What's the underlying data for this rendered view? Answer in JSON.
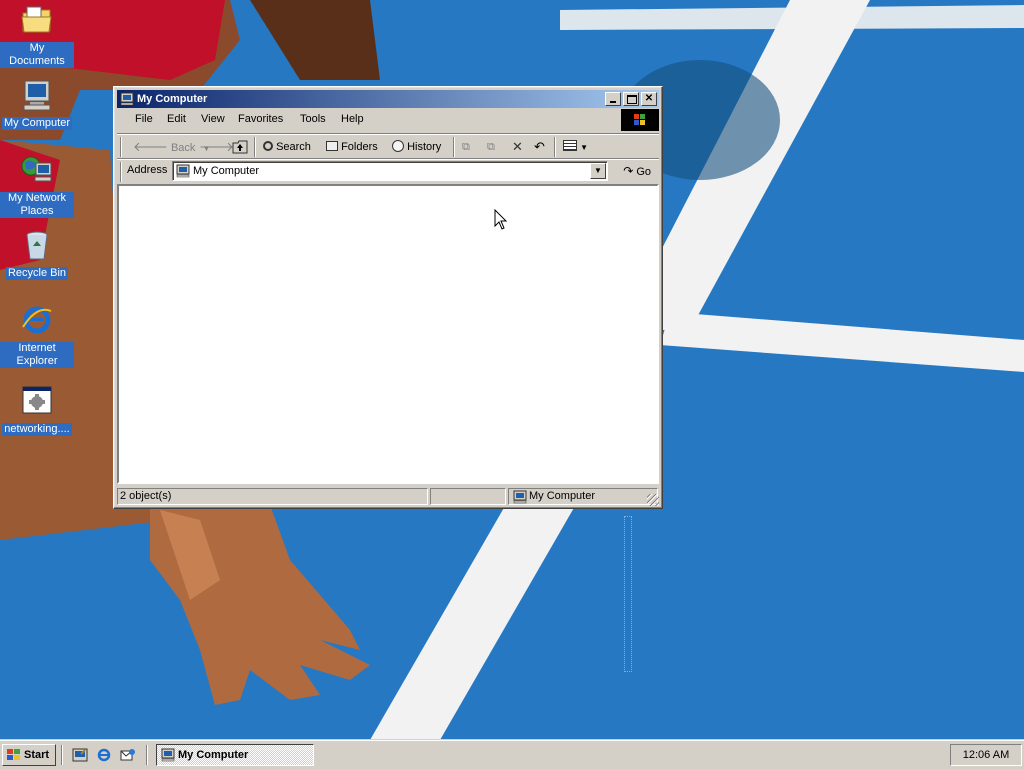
{
  "desktop": {
    "icons": [
      {
        "label": "My Documents",
        "icon": "folder-icon"
      },
      {
        "label": "My Computer",
        "icon": "computer-icon"
      },
      {
        "label": "My Network Places",
        "icon": "network-icon"
      },
      {
        "label": "Recycle Bin",
        "icon": "recycle-bin-icon"
      },
      {
        "label": "Internet Explorer",
        "icon": "ie-icon"
      },
      {
        "label": "networking....",
        "icon": "program-icon"
      }
    ]
  },
  "window": {
    "title": "My Computer",
    "menu": [
      "File",
      "Edit",
      "View",
      "Favorites",
      "Tools",
      "Help"
    ],
    "toolbar": {
      "back": "Back",
      "search": "Search",
      "folders": "Folders",
      "history": "History"
    },
    "address": {
      "label": "Address",
      "value": "My Computer",
      "go": "Go"
    },
    "status": {
      "objects": "2 object(s)",
      "zone": "My Computer"
    }
  },
  "taskbar": {
    "start": "Start",
    "task_label": "My Computer",
    "clock": "12:06 AM"
  },
  "colors": {
    "titlebar_start": "#0a246a",
    "titlebar_end": "#a6caf0",
    "chrome": "#d4d0c8",
    "desktop": "#2a7cc6"
  }
}
